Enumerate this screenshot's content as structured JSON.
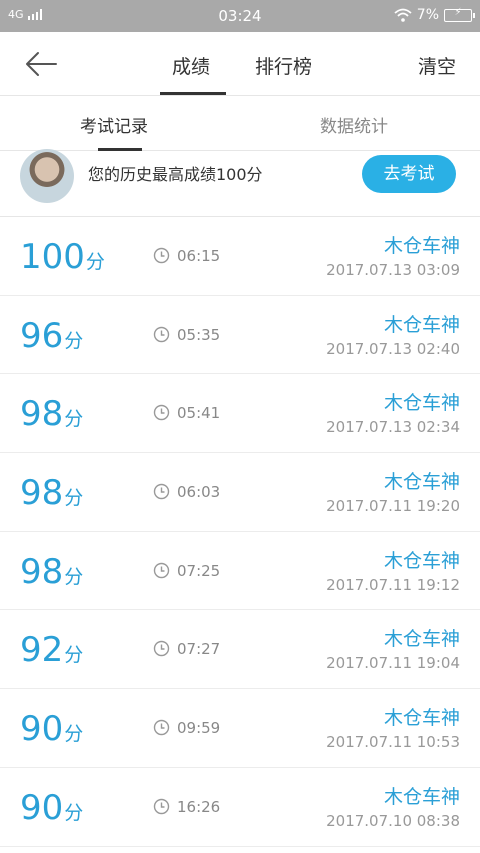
{
  "status_bar": {
    "network": "4G",
    "time": "03:24",
    "battery": "7%"
  },
  "header": {
    "back_icon": "arrow-left-icon",
    "tabs": [
      {
        "label": "成绩"
      },
      {
        "label": "排行榜"
      }
    ],
    "clear_label": "清空"
  },
  "subtabs": [
    {
      "label": "考试记录"
    },
    {
      "label": "数据统计"
    }
  ],
  "best": {
    "text": "您的历史最高成绩100分",
    "button": "去考试"
  },
  "score_unit": "分",
  "records": [
    {
      "score": "100",
      "duration": "06:15",
      "name": "木仓车神",
      "datetime": "2017.07.13  03:09"
    },
    {
      "score": "96",
      "duration": "05:35",
      "name": "木仓车神",
      "datetime": "2017.07.13  02:40"
    },
    {
      "score": "98",
      "duration": "05:41",
      "name": "木仓车神",
      "datetime": "2017.07.13  02:34"
    },
    {
      "score": "98",
      "duration": "06:03",
      "name": "木仓车神",
      "datetime": "2017.07.11  19:20"
    },
    {
      "score": "98",
      "duration": "07:25",
      "name": "木仓车神",
      "datetime": "2017.07.11  19:12"
    },
    {
      "score": "92",
      "duration": "07:27",
      "name": "木仓车神",
      "datetime": "2017.07.11  19:04"
    },
    {
      "score": "90",
      "duration": "09:59",
      "name": "木仓车神",
      "datetime": "2017.07.11  10:53"
    },
    {
      "score": "90",
      "duration": "16:26",
      "name": "木仓车神",
      "datetime": "2017.07.10  08:38"
    }
  ],
  "colors": {
    "accent": "#2a9fd6",
    "button": "#2ab0e5",
    "status_bar": "#a9a9a9"
  }
}
